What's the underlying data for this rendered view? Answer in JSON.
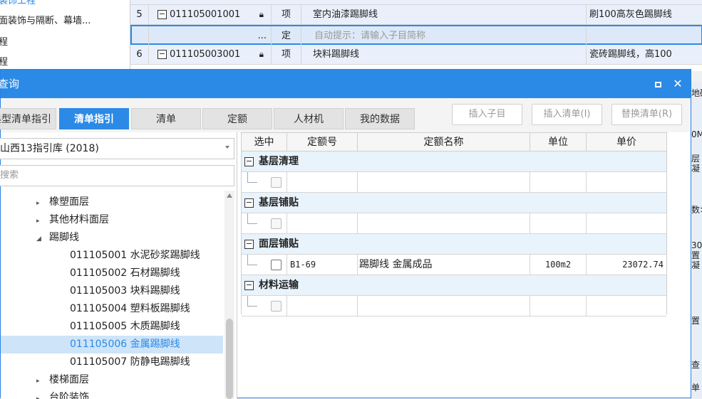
{
  "background": {
    "left_tree": [
      "装饰工程",
      "面装饰与隔断、幕墙...",
      "程",
      "程"
    ],
    "rows": [
      {
        "no": "5",
        "code": "011105001001",
        "lock": true,
        "type": "项",
        "name": "室内油漆踢脚线",
        "feature": "刷100高灰色踢脚线"
      },
      {
        "no": "",
        "code": "",
        "dots": "...",
        "type": "定",
        "name": "自动提示：请输入子目简称",
        "feature": ""
      },
      {
        "no": "6",
        "code": "011105003001",
        "lock": true,
        "type": "项",
        "name": "块料踢脚线",
        "feature": "瓷砖踢脚线，高100"
      }
    ],
    "edge_texts": [
      "地砖",
      "0M",
      "层",
      "凝",
      "数>",
      "30",
      "置",
      "凝",
      "置",
      "查",
      "单"
    ]
  },
  "dialog": {
    "title": "查询",
    "tabs": [
      {
        "label": "典型清单指引",
        "active": false
      },
      {
        "label": "清单指引",
        "active": true
      },
      {
        "label": "清单",
        "active": false
      },
      {
        "label": "定额",
        "active": false
      },
      {
        "label": "人材机",
        "active": false
      },
      {
        "label": "我的数据",
        "active": false
      }
    ],
    "actions": {
      "insert_sub": "插入子目",
      "insert_bill": "插入清单(I)",
      "replace_bill": "替换清单(R)"
    },
    "library": "山西13指引库 (2018)",
    "search_placeholder": "搜索",
    "tree": [
      {
        "label": "橡塑面层",
        "arrow": "▸",
        "level": 1
      },
      {
        "label": "其他材料面层",
        "arrow": "▸",
        "level": 1
      },
      {
        "label": "踢脚线",
        "arrow": "◢",
        "level": 1
      },
      {
        "label": "011105001  水泥砂浆踢脚线",
        "level": 2
      },
      {
        "label": "011105002  石材踢脚线",
        "level": 2
      },
      {
        "label": "011105003  块料踢脚线",
        "level": 2
      },
      {
        "label": "011105004  塑料板踢脚线",
        "level": 2
      },
      {
        "label": "011105005  木质踢脚线",
        "level": 2
      },
      {
        "label": "011105006  金属踢脚线",
        "level": 2,
        "selected": true
      },
      {
        "label": "011105007  防静电踢脚线",
        "level": 2
      },
      {
        "label": "楼梯面层",
        "arrow": "▸",
        "level": 1
      },
      {
        "label": "台阶装饰",
        "arrow": "▸",
        "level": 1
      }
    ],
    "grid": {
      "columns": [
        "选中",
        "定额号",
        "定额名称",
        "单位",
        "单价"
      ],
      "groups": [
        {
          "name": "基层清理",
          "rows": [
            {
              "checked": false,
              "code": "",
              "name": "",
              "unit": "",
              "price": ""
            }
          ]
        },
        {
          "name": "基层铺贴",
          "rows": [
            {
              "checked": false,
              "code": "",
              "name": "",
              "unit": "",
              "price": ""
            }
          ]
        },
        {
          "name": "面层铺贴",
          "rows": [
            {
              "checked": true,
              "code": "B1-69",
              "name": "踢脚线 金属成品",
              "unit": "100m2",
              "price": "23072.74"
            }
          ]
        },
        {
          "name": "材料运输",
          "rows": [
            {
              "checked": false,
              "code": "",
              "name": "",
              "unit": "",
              "price": ""
            }
          ]
        }
      ]
    }
  }
}
